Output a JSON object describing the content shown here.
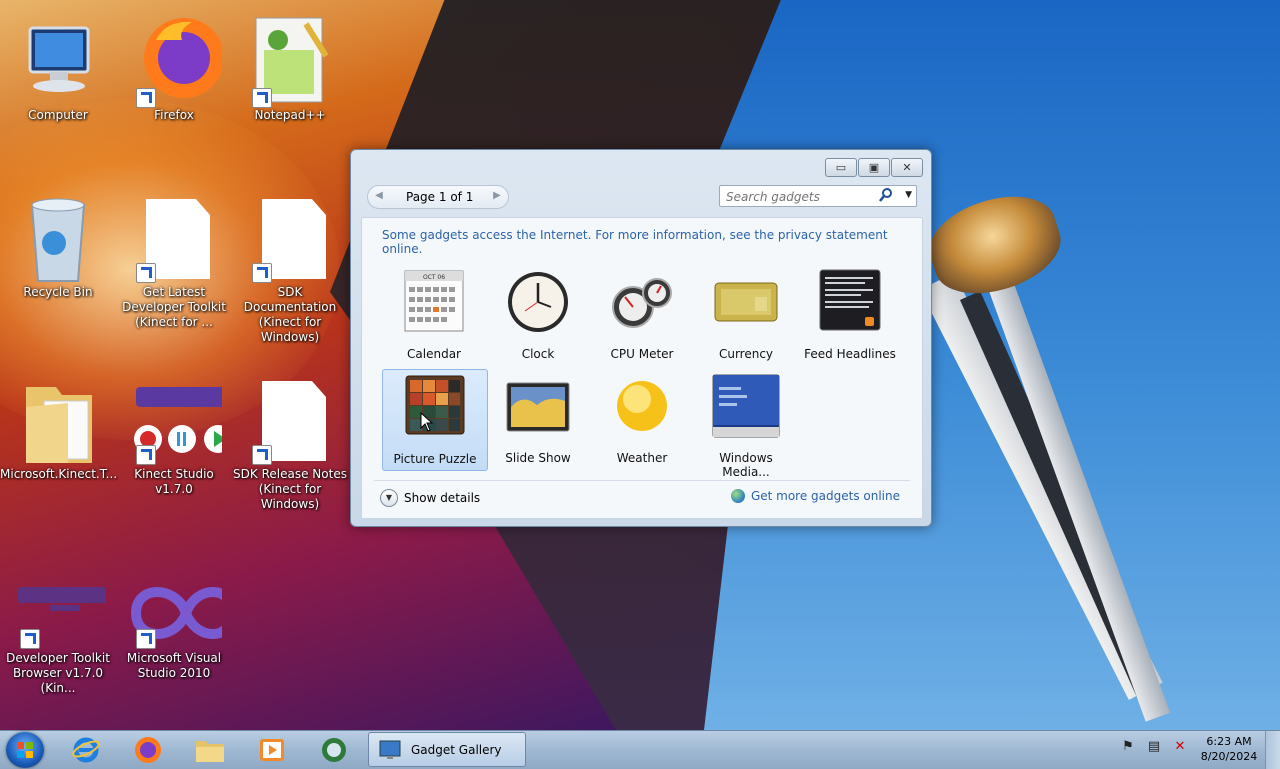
{
  "desktop": {
    "icons": [
      {
        "label": "Computer",
        "icon": "computer-icon"
      },
      {
        "label": "Firefox",
        "icon": "firefox-icon"
      },
      {
        "label": "Notepad++",
        "icon": "notepadpp-icon"
      },
      {
        "label": "Recycle Bin",
        "icon": "recycle-bin-icon"
      },
      {
        "label": "Get Latest Developer Toolkit (Kinect for ...",
        "icon": "document-icon"
      },
      {
        "label": "SDK Documentation (Kinect for Windows)",
        "icon": "document-icon"
      },
      {
        "label": "Microsoft.Kinect.T...",
        "icon": "folder-icon"
      },
      {
        "label": "Kinect Studio v1.7.0",
        "icon": "kinect-studio-icon"
      },
      {
        "label": "SDK Release Notes (Kinect for Windows)",
        "icon": "document-icon"
      },
      {
        "label": "Developer Toolkit Browser v1.7.0 (Kin...",
        "icon": "kinect-sensor-icon"
      },
      {
        "label": "Microsoft Visual Studio 2010",
        "icon": "visual-studio-icon"
      }
    ]
  },
  "gallery": {
    "window_buttons": {
      "minimize": "▭",
      "maximize": "▣",
      "close": "✕"
    },
    "pager": {
      "text": "Page 1 of 1",
      "prev": "◀",
      "next": "▶"
    },
    "search": {
      "placeholder": "Search gadgets"
    },
    "notice": "Some gadgets access the Internet.  For more information, see the privacy statement online.",
    "gadgets": [
      {
        "name": "Calendar",
        "icon": "calendar-icon",
        "selected": false
      },
      {
        "name": "Clock",
        "icon": "clock-icon",
        "selected": false
      },
      {
        "name": "CPU Meter",
        "icon": "cpu-meter-icon",
        "selected": false
      },
      {
        "name": "Currency",
        "icon": "currency-icon",
        "selected": false
      },
      {
        "name": "Feed Headlines",
        "icon": "feed-headlines-icon",
        "selected": false
      },
      {
        "name": "Picture Puzzle",
        "icon": "picture-puzzle-icon",
        "selected": true
      },
      {
        "name": "Slide Show",
        "icon": "slide-show-icon",
        "selected": false
      },
      {
        "name": "Weather",
        "icon": "weather-icon",
        "selected": false
      },
      {
        "name": "Windows Media...",
        "icon": "windows-media-icon",
        "selected": false
      }
    ],
    "calendar_month": "OCT 06",
    "show_details": "Show details",
    "get_more": "Get more gadgets online"
  },
  "taskbar": {
    "pinned": [
      "internet-explorer-icon",
      "firefox-icon",
      "file-explorer-icon",
      "media-player-icon",
      "kinect-icon"
    ],
    "task": {
      "label": "Gadget Gallery",
      "icon": "gadget-gallery-icon"
    },
    "tray": [
      "flag-icon",
      "network-icon",
      "volume-muted-icon"
    ],
    "time": "6:23 AM",
    "date": "8/20/2024"
  },
  "colors": {
    "link": "#2b63a8",
    "accent": "#1f5fc5"
  }
}
